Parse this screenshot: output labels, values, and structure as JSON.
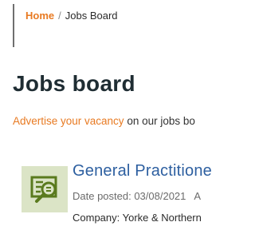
{
  "breadcrumb": {
    "home_label": "Home",
    "separator": "/",
    "current_label": "Jobs Board"
  },
  "page": {
    "title": "Jobs board"
  },
  "intro": {
    "link_text": "Advertise your vacancy",
    "rest_text": " on our jobs bo"
  },
  "job": {
    "icon": "job-document-magnifier-icon",
    "title": "General Practitione",
    "date_posted": "Date posted: 03/08/2021",
    "meta_extra": "A",
    "company": "Company: Yorke & Northern"
  },
  "colors": {
    "accent_orange": "#e87a22",
    "title_dark": "#1f2d33",
    "link_blue": "#2d5fa0",
    "icon_bg": "#dbe4c6",
    "icon_fg": "#5a7a1e"
  }
}
